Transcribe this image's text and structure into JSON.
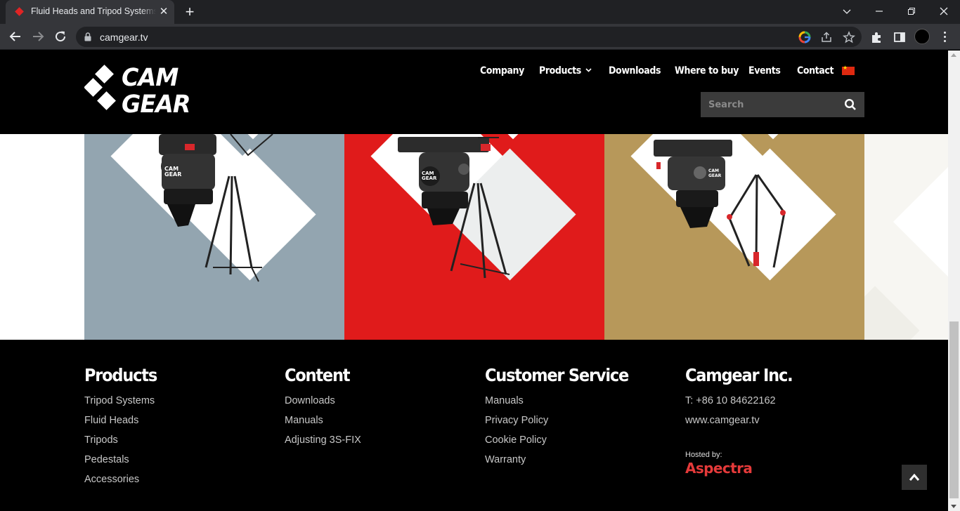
{
  "browser": {
    "tab_title": "Fluid Heads and Tripod Systems - CAMGEAR",
    "url": "camgear.tv"
  },
  "site": {
    "logo_line1": "CAM",
    "logo_line2": "GEAR",
    "nav": {
      "company": "Company",
      "products": "Products",
      "downloads": "Downloads",
      "where_to_buy": "Where to buy",
      "events": "Events",
      "contact": "Contact"
    },
    "search_placeholder": "Search"
  },
  "panels": [
    {
      "color": "#93a5b0"
    },
    {
      "color": "#e01b1b"
    },
    {
      "color": "#b7985a"
    }
  ],
  "footer": {
    "products": {
      "title": "Products",
      "links": [
        "Tripod Systems",
        "Fluid Heads",
        "Tripods",
        "Pedestals",
        "Accessories"
      ]
    },
    "content": {
      "title": "Content",
      "links": [
        "Downloads",
        "Manuals",
        "Adjusting 3S-FIX"
      ]
    },
    "customer_service": {
      "title": "Customer Service",
      "links": [
        "Manuals",
        "Privacy Policy",
        "Cookie Policy",
        "Warranty"
      ]
    },
    "company": {
      "title": "Camgear Inc.",
      "phone": "T: +86 10 84622162",
      "website": "www.camgear.tv"
    },
    "hosted_by_label": "Hosted by:",
    "hosted_by_name": "Aspectra"
  }
}
